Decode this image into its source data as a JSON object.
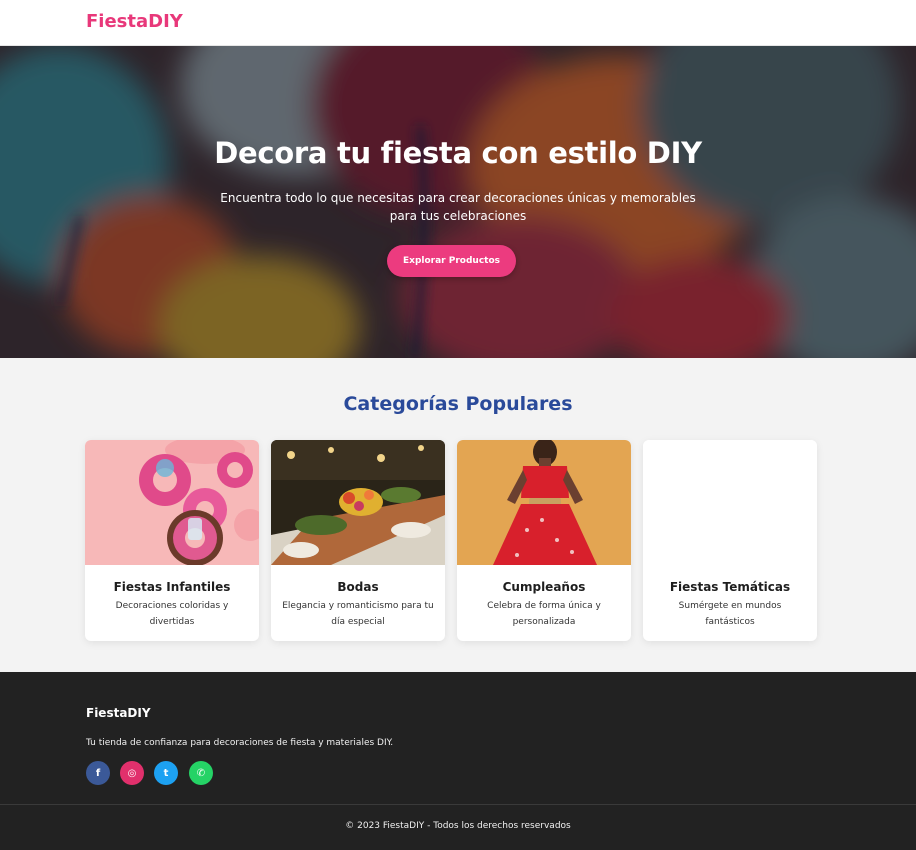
{
  "header": {
    "brand": "FiestaDIY"
  },
  "hero": {
    "title": "Decora tu fiesta con estilo DIY",
    "subtitle": "Encuentra todo lo que necesitas para crear decoraciones únicas y memorables para tus celebraciones",
    "cta_label": "Explorar Productos"
  },
  "categories": {
    "title": "Categorías Populares",
    "items": [
      {
        "name": "Fiestas Infantiles",
        "desc": "Decoraciones coloridas y divertidas",
        "image": "donut-floaties-photo"
      },
      {
        "name": "Bodas",
        "desc": "Elegancia y romanticismo para tu día especial",
        "image": "wedding-table-photo"
      },
      {
        "name": "Cumpleaños",
        "desc": "Celebra de forma única y personalizada",
        "image": "red-dress-woman-photo"
      },
      {
        "name": "Fiestas Temáticas",
        "desc": "Sumérgete en mundos fantásticos",
        "image": ""
      }
    ]
  },
  "footer": {
    "brand": "FiestaDIY",
    "tagline": "Tu tienda de confianza para decoraciones de fiesta y materiales DIY.",
    "social": [
      {
        "name": "facebook-icon",
        "glyph": "f",
        "color": "#3b5998"
      },
      {
        "name": "instagram-icon",
        "glyph": "◎",
        "color": "#e1306c"
      },
      {
        "name": "twitter-icon",
        "glyph": "t",
        "color": "#1da1f2"
      },
      {
        "name": "whatsapp-icon",
        "glyph": "✆",
        "color": "#25d366"
      }
    ],
    "copyright": "© 2023 FiestaDIY - Todos los derechos reservados"
  },
  "colors": {
    "brand": "#e8387a",
    "accent_blue": "#2a4a9a",
    "footer_bg": "#222222",
    "cta": "#ec3b7f"
  }
}
